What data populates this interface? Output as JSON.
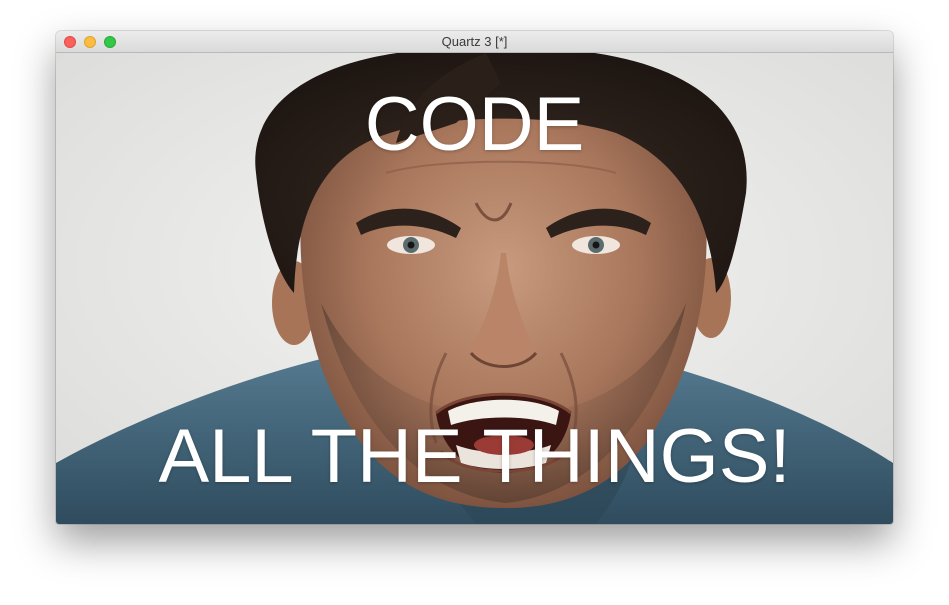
{
  "window": {
    "title": "Quartz 3 [*]"
  },
  "meme": {
    "top_text": "CODE",
    "bottom_text": "ALL THE THINGS!",
    "image": "angry-man-shouting-photo"
  },
  "colors": {
    "caption": "#ffffff",
    "background": "#ececec",
    "shirt": "#3f5f74",
    "skin": "#b8876c"
  }
}
